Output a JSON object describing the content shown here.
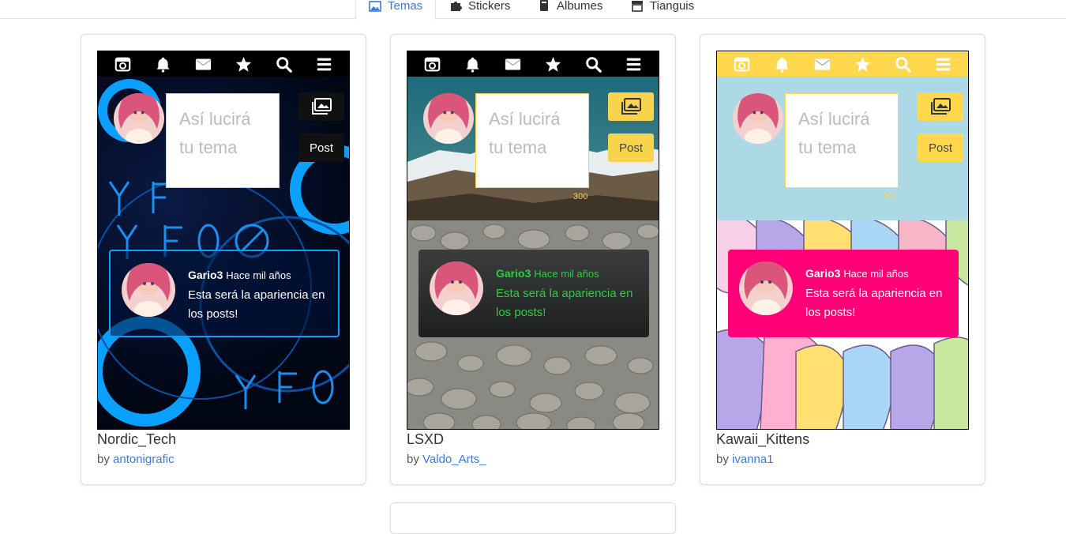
{
  "tabs": [
    {
      "label": "Temas",
      "icon": "image-icon",
      "active": true
    },
    {
      "label": "Stickers",
      "icon": "puzzle-icon",
      "active": false
    },
    {
      "label": "Albumes",
      "icon": "book-icon",
      "active": false
    },
    {
      "label": "Tianguis",
      "icon": "store-icon",
      "active": false
    }
  ],
  "preview_common": {
    "placeholder": "Así lucirá tu tema",
    "post_button": "Post",
    "counter": "300",
    "post_author": "Gario3",
    "post_time": "Hace mil años",
    "post_text": "Esta será la apariencia en los posts!"
  },
  "themes": [
    {
      "name": "Nordic_Tech",
      "by_label": "by",
      "author": "antonigrafic",
      "nav_bg": "#000000",
      "icon_color": "#ffffff",
      "accent": "#00aaff"
    },
    {
      "name": "LSXD",
      "by_label": "by",
      "author": "Valdo_Arts_",
      "nav_bg": "#000000",
      "icon_color": "#ffffff",
      "accent": "#f7d44c",
      "post_text_color": "#2ecc40"
    },
    {
      "name": "Kawaii_Kittens",
      "by_label": "by",
      "author": "ivanna1",
      "nav_bg": "#ffd84d",
      "icon_color": "#ffffff",
      "accent": "#ff0077",
      "header_bg": "#add8e6"
    }
  ]
}
